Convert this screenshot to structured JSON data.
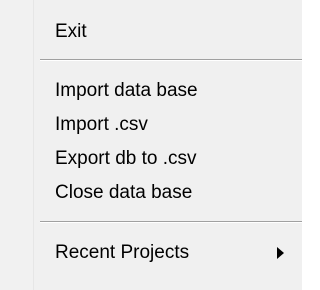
{
  "menu": {
    "items": [
      {
        "label": "Exit"
      },
      {
        "label": "Import data base"
      },
      {
        "label": "Import .csv"
      },
      {
        "label": "Export db to .csv"
      },
      {
        "label": "Close data base"
      },
      {
        "label": "Recent Projects",
        "has_submenu": true,
        "submenu_icon": "triangle-right-icon"
      }
    ]
  }
}
